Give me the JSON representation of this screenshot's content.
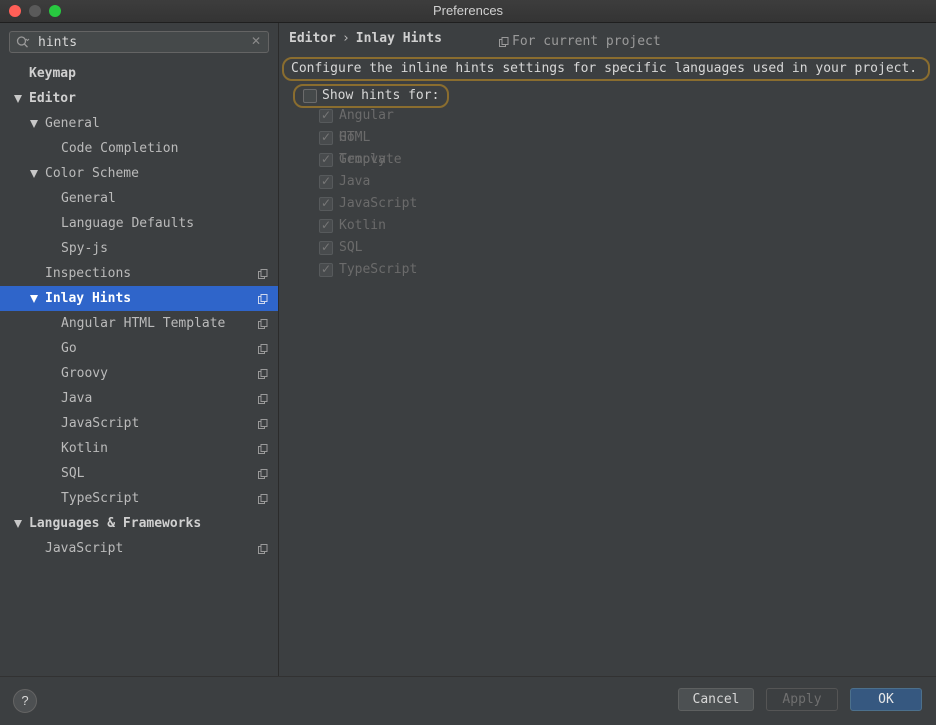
{
  "window": {
    "title": "Preferences"
  },
  "search": {
    "value": "hints",
    "placeholder": ""
  },
  "tree": [
    {
      "label": "Keymap",
      "level": 0,
      "bold": true,
      "arrow": false,
      "copy": false,
      "selected": false
    },
    {
      "label": "Editor",
      "level": 0,
      "bold": true,
      "arrow": true,
      "copy": false,
      "selected": false
    },
    {
      "label": "General",
      "level": 1,
      "bold": false,
      "arrow": true,
      "copy": false,
      "selected": false
    },
    {
      "label": "Code Completion",
      "level": 2,
      "bold": false,
      "arrow": false,
      "copy": false,
      "selected": false
    },
    {
      "label": "Color Scheme",
      "level": 1,
      "bold": false,
      "arrow": true,
      "copy": false,
      "selected": false
    },
    {
      "label": "General",
      "level": 2,
      "bold": false,
      "arrow": false,
      "copy": false,
      "selected": false
    },
    {
      "label": "Language Defaults",
      "level": 2,
      "bold": false,
      "arrow": false,
      "copy": false,
      "selected": false
    },
    {
      "label": "Spy-js",
      "level": 2,
      "bold": false,
      "arrow": false,
      "copy": false,
      "selected": false
    },
    {
      "label": "Inspections",
      "level": 1,
      "bold": false,
      "arrow": false,
      "copy": true,
      "selected": false
    },
    {
      "label": "Inlay Hints",
      "level": 1,
      "bold": true,
      "arrow": true,
      "copy": true,
      "selected": true
    },
    {
      "label": "Angular HTML Template",
      "level": 2,
      "bold": false,
      "arrow": false,
      "copy": true,
      "selected": false
    },
    {
      "label": "Go",
      "level": 2,
      "bold": false,
      "arrow": false,
      "copy": true,
      "selected": false
    },
    {
      "label": "Groovy",
      "level": 2,
      "bold": false,
      "arrow": false,
      "copy": true,
      "selected": false
    },
    {
      "label": "Java",
      "level": 2,
      "bold": false,
      "arrow": false,
      "copy": true,
      "selected": false
    },
    {
      "label": "JavaScript",
      "level": 2,
      "bold": false,
      "arrow": false,
      "copy": true,
      "selected": false
    },
    {
      "label": "Kotlin",
      "level": 2,
      "bold": false,
      "arrow": false,
      "copy": true,
      "selected": false
    },
    {
      "label": "SQL",
      "level": 2,
      "bold": false,
      "arrow": false,
      "copy": true,
      "selected": false
    },
    {
      "label": "TypeScript",
      "level": 2,
      "bold": false,
      "arrow": false,
      "copy": true,
      "selected": false
    },
    {
      "label": "Languages & Frameworks",
      "level": 0,
      "bold": true,
      "arrow": true,
      "copy": false,
      "selected": false
    },
    {
      "label": "JavaScript",
      "level": 1,
      "bold": false,
      "arrow": false,
      "copy": true,
      "selected": false
    }
  ],
  "content": {
    "breadcrumb": [
      "Editor",
      "Inlay Hints"
    ],
    "breadcrumb_separator": "›",
    "scope_label": "For current project",
    "description": "Configure the inline hints settings for specific languages used in your project.",
    "show_hints_label": "Show hints for:",
    "show_hints_checked": false,
    "languages": [
      {
        "label": "Angular HTML Template",
        "checked": true
      },
      {
        "label": "Go",
        "checked": true
      },
      {
        "label": "Groovy",
        "checked": true
      },
      {
        "label": "Java",
        "checked": true
      },
      {
        "label": "JavaScript",
        "checked": true
      },
      {
        "label": "Kotlin",
        "checked": true
      },
      {
        "label": "SQL",
        "checked": true
      },
      {
        "label": "TypeScript",
        "checked": true
      }
    ]
  },
  "footer": {
    "help_label": "?",
    "cancel_label": "Cancel",
    "apply_label": "Apply",
    "ok_label": "OK"
  },
  "colors": {
    "selection": "#2f65ca",
    "highlight_border": "#8a6d2f",
    "ok_button": "#365880"
  }
}
